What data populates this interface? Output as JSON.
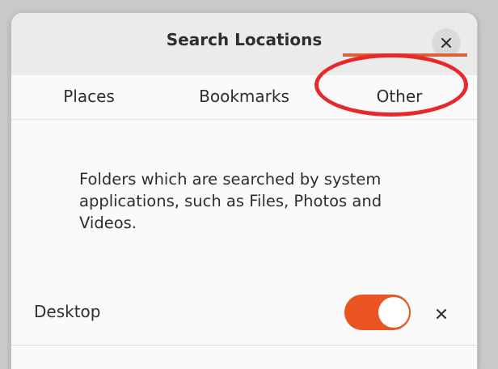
{
  "dialog": {
    "title": "Search Locations"
  },
  "tabs": [
    {
      "label": "Places",
      "selected": false
    },
    {
      "label": "Bookmarks",
      "selected": false
    },
    {
      "label": "Other",
      "selected": true
    }
  ],
  "description": "Folders which are searched by system applications, such as Files, Photos and Videos.",
  "locations": [
    {
      "label": "Desktop",
      "enabled": true
    }
  ],
  "colors": {
    "accent": "#e95420",
    "annotation": "#e8292b"
  },
  "icons": {
    "close": "close-icon",
    "remove": "remove-icon"
  }
}
